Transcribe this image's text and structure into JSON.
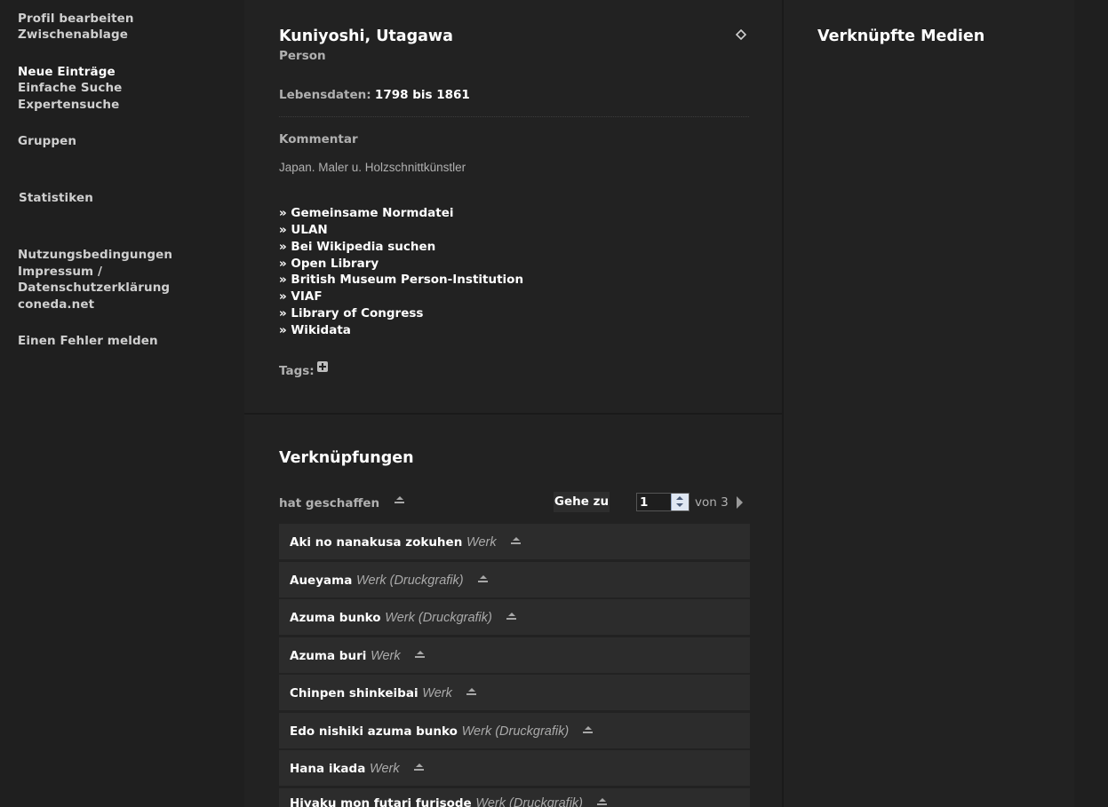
{
  "sidebar": {
    "items": [
      {
        "label": "Profil bearbeiten"
      },
      {
        "label": "Zwischenablage"
      },
      {
        "label": "Neue Einträge"
      },
      {
        "label": "Einfache Suche"
      },
      {
        "label": "Expertensuche"
      },
      {
        "label": "Gruppen"
      },
      {
        "label": "Statistiken"
      },
      {
        "label": "Nutzungsbedingungen"
      },
      {
        "label": "Impressum /"
      },
      {
        "label": "Datenschutzerklärung"
      },
      {
        "label": "coneda.net"
      },
      {
        "label": "Einen Fehler melden"
      }
    ]
  },
  "entity": {
    "title": "Kuniyoshi, Utagawa",
    "kind": "Person",
    "lifespan_label": "Lebensdaten:",
    "lifespan_value": "1798 bis 1861",
    "comment_heading": "Kommentar",
    "comment_text": "Japan. Maler u. Holzschnittkünstler",
    "external_links": [
      "» Gemeinsame Normdatei",
      "» ULAN",
      "» Bei Wikipedia suchen",
      "» Open Library",
      "» British Museum Person-Institution",
      "» VIAF",
      "» Library of Congress",
      "» Wikidata"
    ],
    "tags_label": "Tags:"
  },
  "relations": {
    "heading": "Verknüpfungen",
    "relation_label": "hat geschaffen",
    "goto_label": "Gehe zu",
    "page_value": "1",
    "page_total_text": "von 3",
    "items": [
      {
        "name": "Aki no nanakusa zokuhen",
        "type": "Werk"
      },
      {
        "name": "Aueyama",
        "type": "Werk (Druckgrafik)"
      },
      {
        "name": "Azuma bunko",
        "type": "Werk (Druckgrafik)"
      },
      {
        "name": "Azuma buri",
        "type": "Werk"
      },
      {
        "name": "Chinpen shinkeibai",
        "type": "Werk"
      },
      {
        "name": "Edo nishiki azuma bunko",
        "type": "Werk (Druckgrafik)"
      },
      {
        "name": "Hana ikada",
        "type": "Werk"
      },
      {
        "name": "Hiyaku mon futari furisode",
        "type": "Werk (Druckgrafik)"
      }
    ]
  },
  "media": {
    "heading": "Verknüpfte Medien"
  },
  "colors": {
    "background": "#1f1f1f",
    "panel": "#222222",
    "row": "#2c2c2c",
    "text": "#ffffff",
    "muted": "#b0b0b0"
  }
}
